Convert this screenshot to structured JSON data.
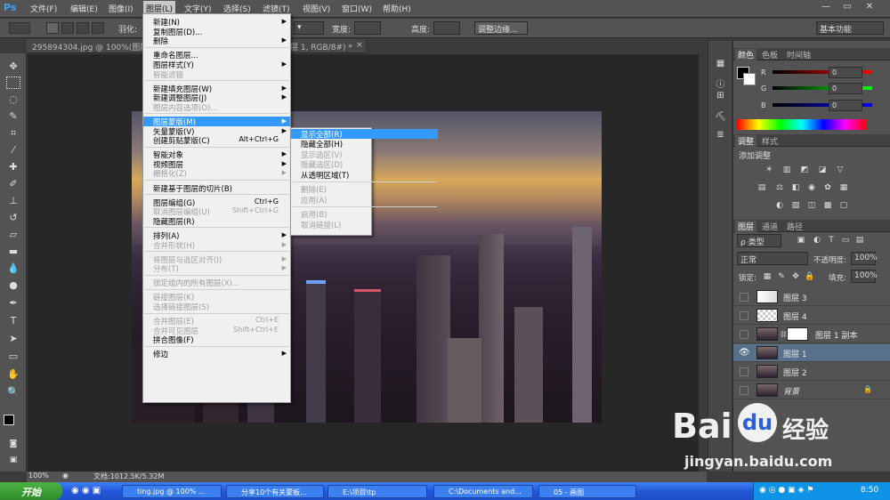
{
  "app": {
    "logo": "Ps",
    "menus": [
      "文件(F)",
      "编辑(E)",
      "图像(I)",
      "图层(L)",
      "文字(Y)",
      "选择(S)",
      "滤镜(T)",
      "视图(V)",
      "窗口(W)",
      "帮助(H)"
    ],
    "window_buttons": [
      "—",
      "▭",
      "✕"
    ]
  },
  "options_bar": {
    "feather_label": "羽化:",
    "width_label": "宽度:",
    "height_label": "高度:",
    "refine_edge_label": "调整边缘...",
    "workspace_label": "基本功能"
  },
  "document": {
    "tab_title": "295894304.jpg @ 100%(图层",
    "tab_title_tail": "层 1, RGB/8#) *",
    "tab_close": "×"
  },
  "layer_menu": {
    "items": [
      {
        "label": "新建(N)",
        "sub": true
      },
      {
        "label": "复制图层(D)..."
      },
      {
        "label": "删除",
        "sub": true
      },
      {
        "sep": true
      },
      {
        "label": "重命名图层..."
      },
      {
        "label": "图层样式(Y)",
        "sub": true
      },
      {
        "label": "智能滤镜",
        "disabled": true
      },
      {
        "sep": true
      },
      {
        "label": "新建填充图层(W)",
        "sub": true
      },
      {
        "label": "新建调整图层(J)",
        "sub": true
      },
      {
        "label": "图层内容选项(O)...",
        "disabled": true
      },
      {
        "sep": true
      },
      {
        "label": "图层蒙版(M)",
        "sub": true,
        "highlight": true
      },
      {
        "label": "矢量蒙版(V)",
        "sub": true
      },
      {
        "label": "创建剪贴蒙版(C)",
        "shortcut": "Alt+Ctrl+G"
      },
      {
        "sep": true
      },
      {
        "label": "智能对象",
        "sub": true
      },
      {
        "label": "视频图层",
        "sub": true
      },
      {
        "label": "栅格化(Z)",
        "sub": true,
        "disabled": true
      },
      {
        "sep": true
      },
      {
        "label": "新建基于图层的切片(B)"
      },
      {
        "sep": true
      },
      {
        "label": "图层编组(G)",
        "shortcut": "Ctrl+G"
      },
      {
        "label": "取消图层编组(U)",
        "shortcut": "Shift+Ctrl+G",
        "disabled": true
      },
      {
        "label": "隐藏图层(R)"
      },
      {
        "sep": true
      },
      {
        "label": "排列(A)",
        "sub": true
      },
      {
        "label": "合并形状(H)",
        "sub": true,
        "disabled": true
      },
      {
        "sep": true
      },
      {
        "label": "将图层与选区对齐(I)",
        "sub": true,
        "disabled": true
      },
      {
        "label": "分布(T)",
        "sub": true,
        "disabled": true
      },
      {
        "sep": true
      },
      {
        "label": "锁定组内的所有图层(X)...",
        "disabled": true
      },
      {
        "sep": true
      },
      {
        "label": "链接图层(K)",
        "disabled": true
      },
      {
        "label": "选择链接图层(S)",
        "disabled": true
      },
      {
        "sep": true
      },
      {
        "label": "合并图层(E)",
        "shortcut": "Ctrl+E",
        "disabled": true
      },
      {
        "label": "合并可见图层",
        "shortcut": "Shift+Ctrl+E",
        "disabled": true
      },
      {
        "label": "拼合图像(F)"
      },
      {
        "sep": true
      },
      {
        "label": "修边",
        "sub": true
      }
    ]
  },
  "mask_submenu": {
    "items": [
      {
        "label": "显示全部(R)",
        "highlight": true
      },
      {
        "label": "隐藏全部(H)"
      },
      {
        "label": "显示选区(V)",
        "disabled": true
      },
      {
        "label": "隐藏选区(D)",
        "disabled": true
      },
      {
        "label": "从透明区域(T)"
      },
      {
        "sep": true
      },
      {
        "label": "删除(E)",
        "disabled": true
      },
      {
        "label": "应用(A)",
        "disabled": true
      },
      {
        "sep": true
      },
      {
        "label": "启用(B)",
        "disabled": true
      },
      {
        "label": "取消链接(L)",
        "disabled": true
      }
    ]
  },
  "color_panel": {
    "tabs": [
      "颜色",
      "色板",
      "时间轴"
    ],
    "r_label": "R",
    "g_label": "G",
    "b_label": "B",
    "r_value": "0",
    "g_value": "0",
    "b_value": "0"
  },
  "adjust_panel": {
    "tabs": [
      "调整",
      "样式"
    ],
    "title": "添加调整"
  },
  "layers_panel": {
    "tabs": [
      "图层",
      "通道",
      "路径"
    ],
    "filter_label": "ρ 类型",
    "blend_mode": "正常",
    "opacity_label": "不透明度:",
    "opacity_value": "100%",
    "lock_label": "锁定:",
    "fill_label": "填充:",
    "fill_value": "100%",
    "layers": [
      {
        "name": "图层 3",
        "visible": false,
        "selected": false
      },
      {
        "name": "图层 4",
        "visible": false,
        "selected": false
      },
      {
        "name": "图层 1 副本",
        "visible": false,
        "selected": false,
        "mask": true
      },
      {
        "name": "图层 1",
        "visible": true,
        "selected": true
      },
      {
        "name": "图层 2",
        "visible": false,
        "selected": false
      },
      {
        "name": "背景",
        "visible": false,
        "selected": false,
        "locked": true
      }
    ]
  },
  "status_bar": {
    "zoom": "100%",
    "doc_info": "文档:1012.5K/5.32M"
  },
  "taskbar": {
    "start_label": "开始",
    "tasks": [
      "ting.jpg @ 100% ...",
      "分享10个有关蒙板...",
      "E:\\项目\\tp",
      "C:\\Documents and...",
      "05 - 画图"
    ],
    "clock": "8:50"
  },
  "watermark": {
    "brand": "Bai",
    "brand_cn": "经验",
    "url": "jingyan.baidu.com"
  },
  "colors": {
    "menu_highlight": "#3399ff",
    "ps_blue": "#33a4ff",
    "selected_layer": "#59708a",
    "baidu_blue": "#2d5fd7"
  }
}
